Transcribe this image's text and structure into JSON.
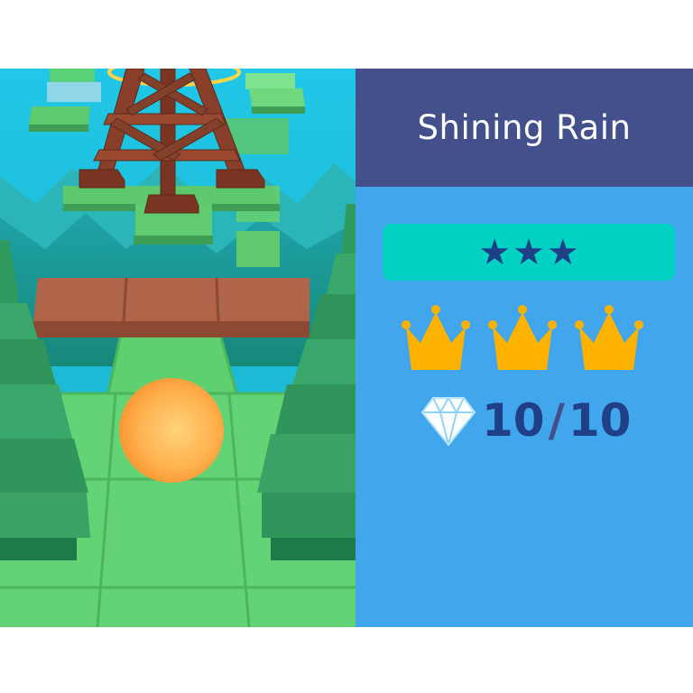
{
  "level": {
    "title": "Shining Rain"
  },
  "rating": {
    "stars_earned": 3,
    "stars_total": 3,
    "star_glyph": "★",
    "crowns_earned": 3,
    "crowns_total": 3
  },
  "gems": {
    "collected": "10",
    "separator": "/",
    "total": "10"
  },
  "colors": {
    "header_bg": "#43508c",
    "panel_bg": "#42a6ec",
    "stars_bar_bg": "#00d1c2",
    "star_color": "#1f3f87",
    "crown_color": "#ffb200",
    "player_ball": "#ffa437"
  },
  "icons": {
    "crown": "crown-icon",
    "gem": "diamond-icon",
    "star": "star-icon"
  }
}
